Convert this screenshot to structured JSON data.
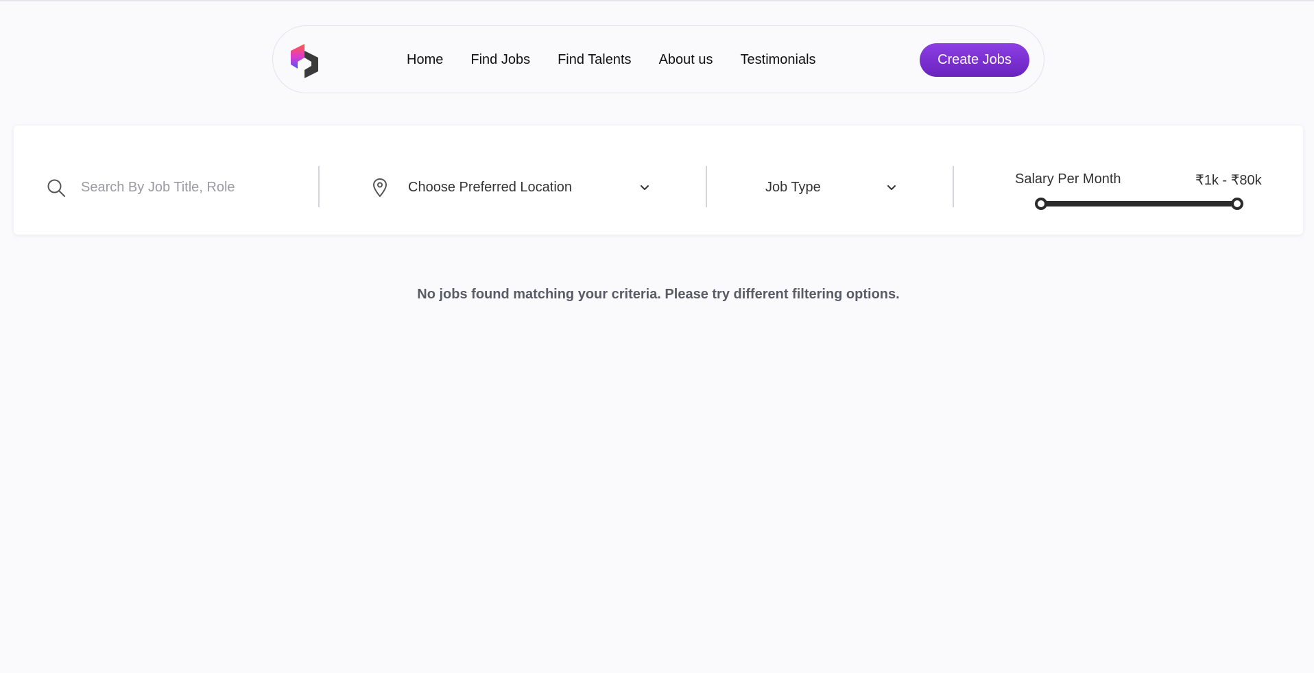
{
  "nav": {
    "links": [
      {
        "label": "Home"
      },
      {
        "label": "Find Jobs"
      },
      {
        "label": "Find Talents"
      },
      {
        "label": "About us"
      },
      {
        "label": "Testimonials"
      }
    ],
    "cta_label": "Create Jobs"
  },
  "filters": {
    "search_placeholder": "Search By Job Title, Role",
    "location_label": "Choose Preferred Location",
    "job_type_label": "Job Type",
    "salary_label": "Salary Per Month",
    "salary_range": "₹1k - ₹80k",
    "salary_slider": {
      "min_fraction": 0,
      "max_fraction": 1
    }
  },
  "empty_message": "No jobs found matching your criteria. Please try different filtering options.",
  "colors": {
    "accent": "#7a30d2",
    "background": "#fafafd"
  }
}
